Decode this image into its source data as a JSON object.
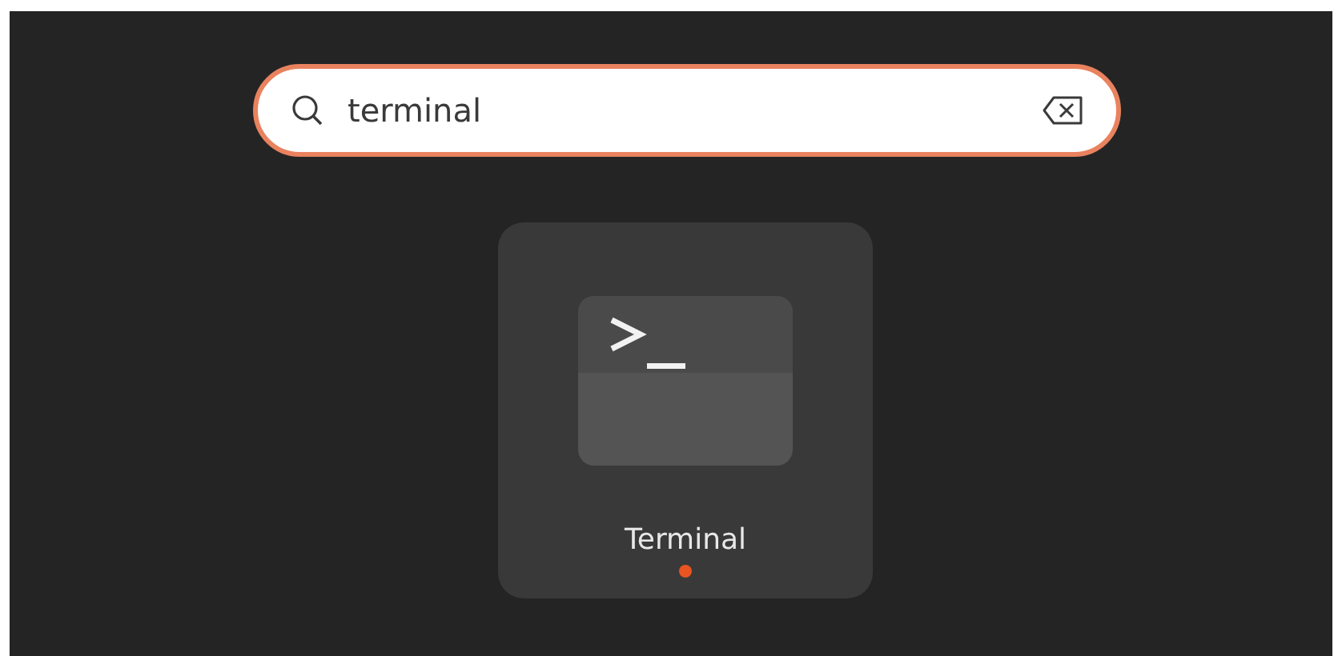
{
  "search": {
    "value": "terminal"
  },
  "results": [
    {
      "label": "Terminal",
      "running": true
    }
  ]
}
